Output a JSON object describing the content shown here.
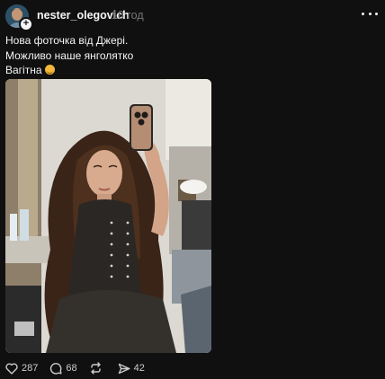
{
  "post": {
    "username": "nester_olegovich",
    "timestamp": "18 год",
    "caption_lines": [
      "Нова фоточка від Джері.",
      "Можливо наше янголятко",
      "Вагітна"
    ],
    "caption_emoji": "smiling-face-icon"
  },
  "actions": {
    "likes": "287",
    "replies": "68",
    "shares": "42"
  },
  "icons": {
    "like": "heart-icon",
    "reply": "speech-bubble-icon",
    "repost": "repost-icon",
    "share": "send-icon",
    "more": "more-dots-icon"
  },
  "colors": {
    "background": "#101010",
    "text": "#f3f5f7",
    "secondary": "#777777"
  }
}
